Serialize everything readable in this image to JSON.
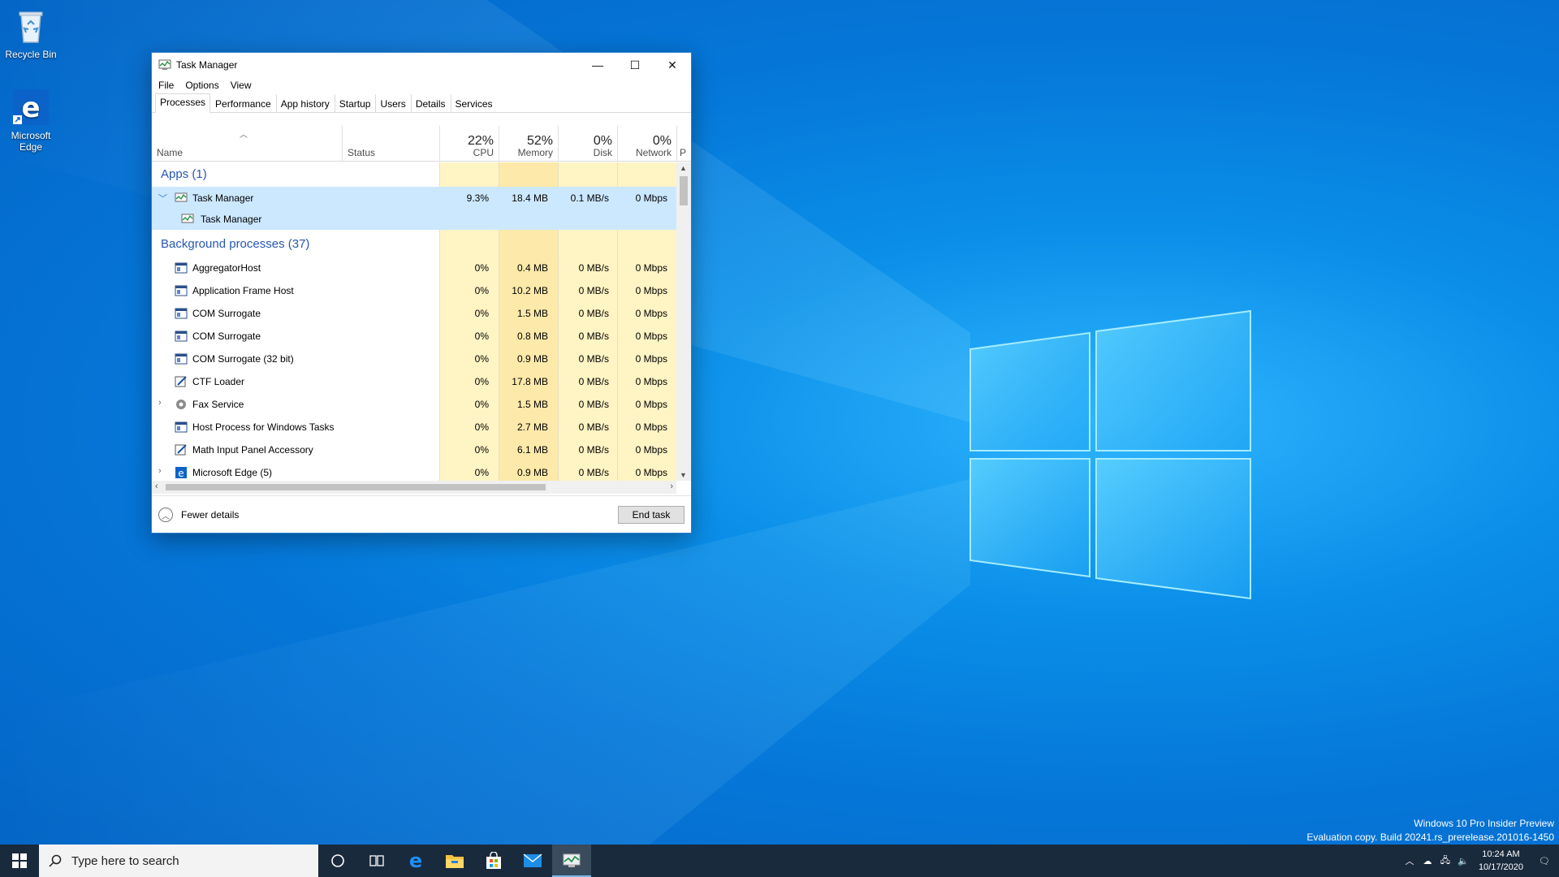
{
  "desktop": {
    "icons": [
      {
        "label": "Recycle Bin"
      },
      {
        "label": "Microsoft\nEdge",
        "line1": "Microsoft",
        "line2": "Edge"
      }
    ]
  },
  "window": {
    "title": "Task Manager",
    "controls": {
      "minimize": "—",
      "maximize": "☐",
      "close": "✕"
    },
    "menu": [
      "File",
      "Options",
      "View"
    ],
    "tabs": [
      "Processes",
      "Performance",
      "App history",
      "Startup",
      "Users",
      "Details",
      "Services"
    ],
    "active_tab": "Processes",
    "columns": {
      "name": "Name",
      "status": "Status",
      "cpu": {
        "label": "CPU",
        "pct": "22%"
      },
      "memory": {
        "label": "Memory",
        "pct": "52%"
      },
      "disk": {
        "label": "Disk",
        "pct": "0%"
      },
      "network": {
        "label": "Network",
        "pct": "0%"
      },
      "more": "P"
    },
    "groups": {
      "apps": "Apps (1)",
      "background": "Background processes (37)"
    },
    "apps": [
      {
        "name": "Task Manager",
        "cpu": "9.3%",
        "memory": "18.4 MB",
        "disk": "0.1 MB/s",
        "network": "0 Mbps",
        "child": "Task Manager"
      }
    ],
    "background": [
      {
        "name": "AggregatorHost",
        "cpu": "0%",
        "memory": "0.4 MB",
        "disk": "0 MB/s",
        "network": "0 Mbps"
      },
      {
        "name": "Application Frame Host",
        "cpu": "0%",
        "memory": "10.2 MB",
        "disk": "0 MB/s",
        "network": "0 Mbps"
      },
      {
        "name": "COM Surrogate",
        "cpu": "0%",
        "memory": "1.5 MB",
        "disk": "0 MB/s",
        "network": "0 Mbps"
      },
      {
        "name": "COM Surrogate",
        "cpu": "0%",
        "memory": "0.8 MB",
        "disk": "0 MB/s",
        "network": "0 Mbps"
      },
      {
        "name": "COM Surrogate (32 bit)",
        "cpu": "0%",
        "memory": "0.9 MB",
        "disk": "0 MB/s",
        "network": "0 Mbps"
      },
      {
        "name": "CTF Loader",
        "cpu": "0%",
        "memory": "17.8 MB",
        "disk": "0 MB/s",
        "network": "0 Mbps"
      },
      {
        "name": "Fax Service",
        "cpu": "0%",
        "memory": "1.5 MB",
        "disk": "0 MB/s",
        "network": "0 Mbps"
      },
      {
        "name": "Host Process for Windows Tasks",
        "cpu": "0%",
        "memory": "2.7 MB",
        "disk": "0 MB/s",
        "network": "0 Mbps"
      },
      {
        "name": "Math Input Panel Accessory",
        "cpu": "0%",
        "memory": "6.1 MB",
        "disk": "0 MB/s",
        "network": "0 Mbps"
      },
      {
        "name": "Microsoft Edge (5)",
        "cpu": "0%",
        "memory": "0.9 MB",
        "disk": "0 MB/s",
        "network": "0 Mbps"
      }
    ],
    "footer": {
      "fewer_details": "Fewer details",
      "end_task": "End task"
    }
  },
  "watermark": {
    "line1": "Windows 10 Pro Insider Preview",
    "line2": "Evaluation copy. Build 20241.rs_prerelease.201016-1450"
  },
  "taskbar": {
    "search_placeholder": "Type here to search",
    "clock_time": "10:24 AM",
    "clock_date": "10/17/2020",
    "accent": "#76b9ed"
  }
}
